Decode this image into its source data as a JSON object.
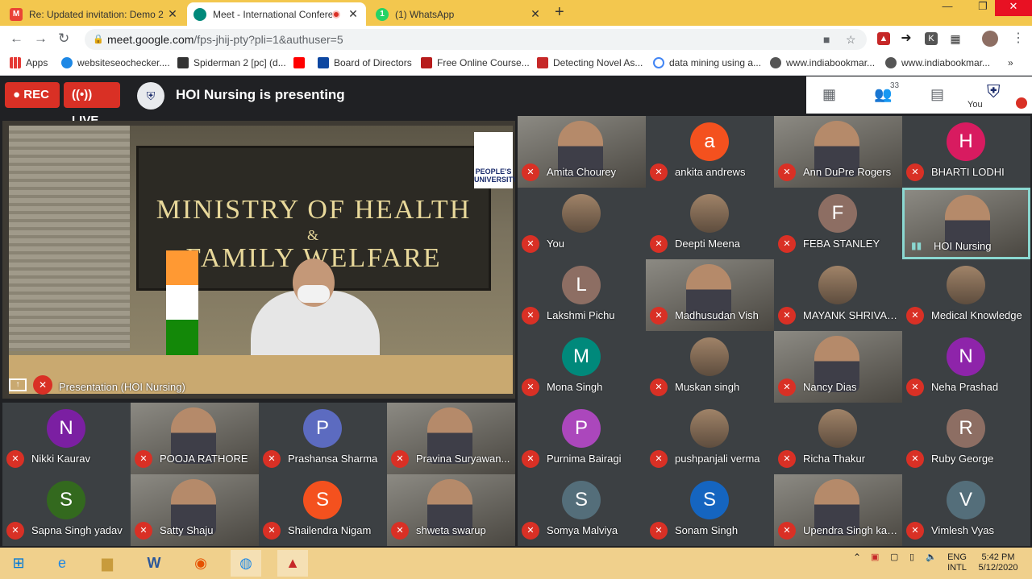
{
  "browser": {
    "tabs": [
      {
        "title": "Re: Updated invitation: Demo 2 (",
        "favicon": "gmail-icon"
      },
      {
        "title": "Meet - International Confere",
        "favicon": "meet-icon",
        "recording": true
      },
      {
        "title": "(1) WhatsApp",
        "favicon": "whatsapp-icon",
        "badge": "1"
      }
    ],
    "url_host": "meet.google.com",
    "url_path": "/fps-jhij-pty?pli=1&authuser=5",
    "bookmarks": [
      "Apps",
      "websiteseochecker....",
      "Spiderman 2 [pc] (d...",
      "",
      "Board of Directors",
      "Free Online Course...",
      "Detecting Novel As...",
      "data mining using a...",
      "www.indiabookmar...",
      "www.indiabookmar..."
    ],
    "more_bookmarks": "»"
  },
  "meet": {
    "rec_label": "REC",
    "live_label": "LIVE",
    "presenting_text": "HOI Nursing is presenting",
    "participant_count": "33",
    "you_label": "You",
    "presentation": {
      "caption": "Presentation (HOI Nursing)",
      "sign_line1": "MINISTRY OF HEALTH",
      "sign_line2": "&",
      "sign_line3": "FAMILY WELFARE",
      "university": "PEOPLE'S UNIVERSITY"
    },
    "participants": [
      {
        "name": "Amita Chourey",
        "type": "video"
      },
      {
        "name": "ankita andrews",
        "type": "letter",
        "letter": "a",
        "color": "#f4511e"
      },
      {
        "name": "Ann DuPre Rogers",
        "type": "video"
      },
      {
        "name": "BHARTI LODHI",
        "type": "letter",
        "letter": "H",
        "color": "#d81b60"
      },
      {
        "name": "You",
        "type": "photo"
      },
      {
        "name": "Deepti Meena",
        "type": "photo"
      },
      {
        "name": "FEBA STANLEY",
        "type": "letter",
        "letter": "F",
        "color": "#8d6e63"
      },
      {
        "name": "HOI Nursing",
        "type": "video",
        "speaking": true
      },
      {
        "name": "Lakshmi Pichu",
        "type": "letter",
        "letter": "L",
        "color": "#8d6e63"
      },
      {
        "name": "Madhusudan Vish",
        "type": "video"
      },
      {
        "name": "MAYANK SHRIVAS...",
        "type": "photo"
      },
      {
        "name": "Medical Knowledge",
        "type": "photo"
      },
      {
        "name": "Mona Singh",
        "type": "letter",
        "letter": "M",
        "color": "#00897b"
      },
      {
        "name": "Muskan singh",
        "type": "photo"
      },
      {
        "name": "Nancy Dias",
        "type": "video"
      },
      {
        "name": "Neha Prashad",
        "type": "letter",
        "letter": "N",
        "color": "#8e24aa"
      },
      {
        "name": "Nikki Kaurav",
        "type": "letter",
        "letter": "N",
        "color": "#7b1fa2"
      },
      {
        "name": "POOJA RATHORE",
        "type": "video"
      },
      {
        "name": "Prashansa Sharma",
        "type": "letter",
        "letter": "P",
        "color": "#5c6bc0"
      },
      {
        "name": "Pravina Suryawan...",
        "type": "video"
      },
      {
        "name": "Purnima Bairagi",
        "type": "letter",
        "letter": "P",
        "color": "#ab47bc"
      },
      {
        "name": "pushpanjali verma",
        "type": "photo"
      },
      {
        "name": "Richa Thakur",
        "type": "photo"
      },
      {
        "name": "Ruby George",
        "type": "letter",
        "letter": "R",
        "color": "#8d6e63"
      },
      {
        "name": "Sapna Singh yadav",
        "type": "letter",
        "letter": "S",
        "color": "#33691e"
      },
      {
        "name": "Satty Shaju",
        "type": "video"
      },
      {
        "name": "Shailendra Nigam",
        "type": "letter",
        "letter": "S",
        "color": "#f4511e"
      },
      {
        "name": "shweta swarup",
        "type": "video"
      },
      {
        "name": "Somya Malviya",
        "type": "letter",
        "letter": "S",
        "color": "#546e7a"
      },
      {
        "name": "Sonam Singh",
        "type": "letter",
        "letter": "S",
        "color": "#1565c0"
      },
      {
        "name": "Upendra Singh kan...",
        "type": "video"
      },
      {
        "name": "Vimlesh Vyas",
        "type": "letter",
        "letter": "V",
        "color": "#546e7a"
      }
    ]
  },
  "taskbar": {
    "language_line1": "ENG",
    "language_line2": "INTL",
    "time": "5:42 PM",
    "date": "5/12/2020"
  }
}
